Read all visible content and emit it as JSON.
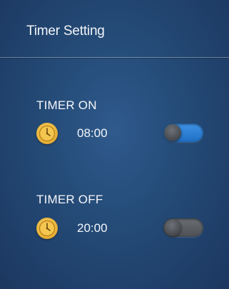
{
  "header": {
    "title": "Timer Setting"
  },
  "timer_on": {
    "label": "TIMER ON",
    "time": "08:00",
    "enabled": true,
    "icon": "clock-icon"
  },
  "timer_off": {
    "label": "TIMER OFF",
    "time": "20:00",
    "enabled": false,
    "icon": "clock-icon"
  },
  "colors": {
    "background": "#244a76",
    "toggle_on": "#2a7fd6",
    "toggle_off": "#5b5f64",
    "clock": "#e9b33a"
  }
}
